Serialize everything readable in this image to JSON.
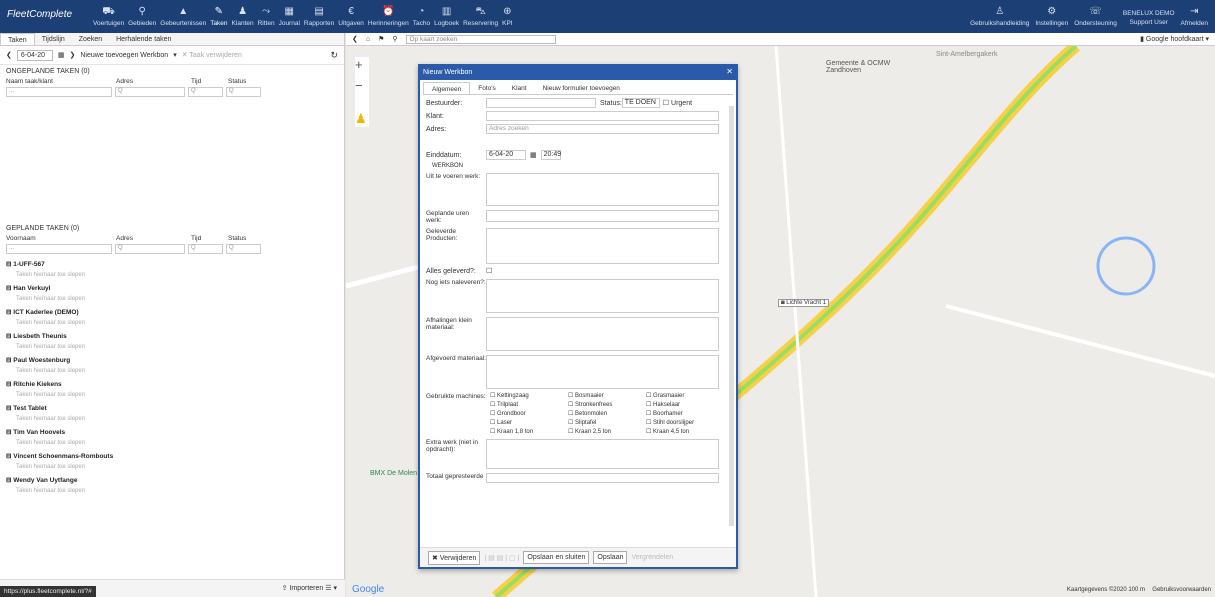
{
  "app": {
    "logo": "FleetComplete"
  },
  "topnav": [
    {
      "icon": "car",
      "label": "Voertuigen"
    },
    {
      "icon": "pin",
      "label": "Gebieden"
    },
    {
      "icon": "warning",
      "label": "Gebeurtenissen"
    },
    {
      "icon": "wrench",
      "label": "Taken"
    },
    {
      "icon": "person",
      "label": "Klanten"
    },
    {
      "icon": "route",
      "label": "Ritten"
    },
    {
      "icon": "calendar",
      "label": "Journal"
    },
    {
      "icon": "doc",
      "label": "Rapporten"
    },
    {
      "icon": "euro",
      "label": "Uitgaven"
    },
    {
      "icon": "bell",
      "label": "Herinneringen"
    },
    {
      "icon": "tacho",
      "label": "Tacho"
    },
    {
      "icon": "book",
      "label": "Logboek"
    },
    {
      "icon": "car2",
      "label": "Reservering"
    },
    {
      "icon": "globe",
      "label": "KPI"
    }
  ],
  "rightnav": [
    {
      "label": "Gebruikshandleiding"
    },
    {
      "label": "Instellingen"
    },
    {
      "label": "Ondersteuning"
    },
    {
      "label": "BENELUX DEMO",
      "sub": "Support User"
    },
    {
      "label": "Afmelden"
    }
  ],
  "left": {
    "tabs": [
      "Taken",
      "Tijdslijn",
      "Zoeken",
      "Herhalende taken"
    ],
    "date": "6-04-20",
    "add_label": "Nieuwe toevoegen Werkbon",
    "remove_label": "Taak verwijderen",
    "unplanned_title": "ONGEPLANDE TAKEN (0)",
    "cols1": [
      "Naam taak/klant",
      "Adres",
      "Tijd",
      "Status"
    ],
    "planned_title": "GEPLANDE TAKEN (0)",
    "cols2": [
      "Voornaam",
      "Adres",
      "Tijd",
      "Status"
    ],
    "drag_hint": "Taken hiernaar toe slepen",
    "groups": [
      "1-UFF-567",
      "Han Verkuyl",
      "ICT Kaderlee (DEMO)",
      "Liesbeth Theunis",
      "Paul Woestenburg",
      "Ritchie Kiekens",
      "Test Tablet",
      "Tim Van Hoovels",
      "Vincent Schoenmans-Rombouts",
      "Wendy Van Uytfange"
    ],
    "import_label": "Importeren",
    "url": "https://plus.fleetcomplete.nl/?#"
  },
  "mapbar": {
    "search_placeholder": "Op kaart zoeken",
    "layer": "Google hoofdkaart"
  },
  "map": {
    "labels": [
      "Sint-Amelbergakerk",
      "Gemeente & OCMW Zandhoven",
      "BMX De Molen",
      "Lichte Vracht 1"
    ],
    "footer": "Kaartgegevens ©2020  100 m",
    "report": "Gebruiksvoorwaarden",
    "brand": "Google"
  },
  "dialog": {
    "title": "Nieuw Werkbon",
    "tabs": [
      "Algemeen",
      "Foto's",
      "Klant",
      "Nieuw formulier toevoegen"
    ],
    "fields": {
      "driver": "Bestuurder:",
      "status_label": "Status:",
      "status_value": "TE DOEN",
      "urgent": "Urgent",
      "client": "Klant:",
      "address": "Adres:",
      "address_ph": "Adres zoeken",
      "enddate": "Einddatum:",
      "date_val": "6-04-20",
      "time_val": "20:49",
      "section": "WERKBON"
    },
    "textareas": [
      "Uit te voeren werk:",
      "Geplande uren werk:",
      "Geleverde Producten:"
    ],
    "delivered": "Alles geleverd?:",
    "textareas2": [
      "Nog iets naleveren?:",
      "Afhalingen klein materiaal:",
      "Afgevoerd materiaal:"
    ],
    "machines_label": "Gebruikte machines:",
    "machines": [
      "Kettingzaag",
      "Bosmaaier",
      "Grasmaaier",
      "Trilplaat",
      "Stronkenfrees",
      "Hakselaar",
      "Grondboor",
      "Betonmolen",
      "Boorhamer",
      "Laser",
      "Sliptafel",
      "Stihl doorslijper",
      "Kraan 1,8 ton",
      "Kraan 2,5 ton",
      "Kraan 4,5 ton"
    ],
    "extra": "Extra werk (niet in opdracht):",
    "total": "Totaal gepresteerde",
    "buttons": {
      "delete": "Verwijderen",
      "save_close": "Opslaan en sluiten",
      "save": "Opslaan",
      "close": "Vergrendelen"
    }
  }
}
